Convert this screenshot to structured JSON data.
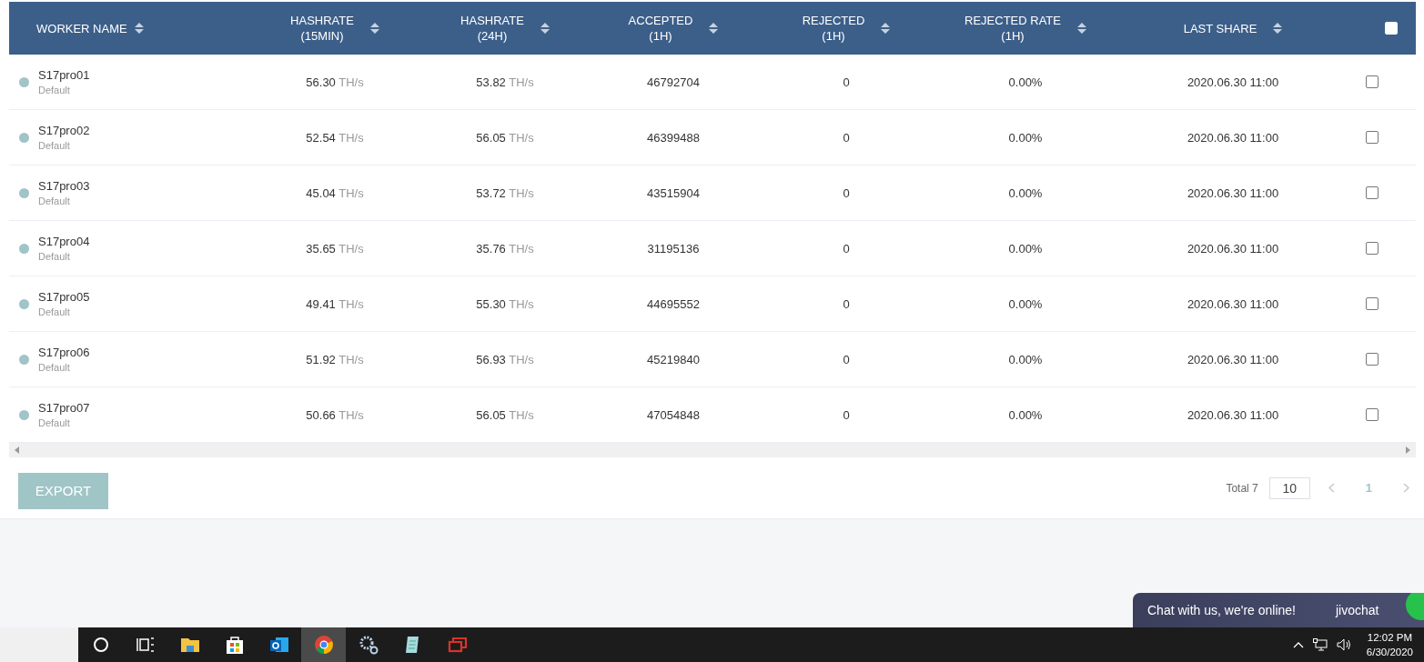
{
  "table": {
    "columns": [
      {
        "label": "WORKER NAME"
      },
      {
        "label": "HASHRATE\n(15MIN)"
      },
      {
        "label": "HASHRATE\n(24H)"
      },
      {
        "label": "ACCEPTED\n(1H)"
      },
      {
        "label": "REJECTED\n(1H)"
      },
      {
        "label": "REJECTED RATE\n(1H)"
      },
      {
        "label": "LAST SHARE"
      }
    ],
    "select_all": {
      "checked": false
    },
    "rows": [
      {
        "name": "S17pro01",
        "group": "Default",
        "color": "#a0c4c8",
        "hashrate_15min": "56.30",
        "unit_15min": "TH/s",
        "hashrate_24h": "53.82",
        "unit_24h": "TH/s",
        "accepted": "46792704",
        "rejected": "0",
        "rejected_rate": "0.00%",
        "last_share": "2020.06.30 11:00",
        "checked": false
      },
      {
        "name": "S17pro02",
        "group": "Default",
        "color": "#a0c4c8",
        "hashrate_15min": "52.54",
        "unit_15min": "TH/s",
        "hashrate_24h": "56.05",
        "unit_24h": "TH/s",
        "accepted": "46399488",
        "rejected": "0",
        "rejected_rate": "0.00%",
        "last_share": "2020.06.30 11:00",
        "checked": false
      },
      {
        "name": "S17pro03",
        "group": "Default",
        "color": "#a0c4c8",
        "hashrate_15min": "45.04",
        "unit_15min": "TH/s",
        "hashrate_24h": "53.72",
        "unit_24h": "TH/s",
        "accepted": "43515904",
        "rejected": "0",
        "rejected_rate": "0.00%",
        "last_share": "2020.06.30 11:00",
        "checked": false
      },
      {
        "name": "S17pro04",
        "group": "Default",
        "color": "#a0c4c8",
        "hashrate_15min": "35.65",
        "unit_15min": "TH/s",
        "hashrate_24h": "35.76",
        "unit_24h": "TH/s",
        "accepted": "31195136",
        "rejected": "0",
        "rejected_rate": "0.00%",
        "last_share": "2020.06.30 11:00",
        "checked": false
      },
      {
        "name": "S17pro05",
        "group": "Default",
        "color": "#a0c4c8",
        "hashrate_15min": "49.41",
        "unit_15min": "TH/s",
        "hashrate_24h": "55.30",
        "unit_24h": "TH/s",
        "accepted": "44695552",
        "rejected": "0",
        "rejected_rate": "0.00%",
        "last_share": "2020.06.30 11:00",
        "checked": false
      },
      {
        "name": "S17pro06",
        "group": "Default",
        "color": "#a0c4c8",
        "hashrate_15min": "51.92",
        "unit_15min": "TH/s",
        "hashrate_24h": "56.93",
        "unit_24h": "TH/s",
        "accepted": "45219840",
        "rejected": "0",
        "rejected_rate": "0.00%",
        "last_share": "2020.06.30 11:00",
        "checked": false
      },
      {
        "name": "S17pro07",
        "group": "Default",
        "color": "#a0c4c8",
        "hashrate_15min": "50.66",
        "unit_15min": "TH/s",
        "hashrate_24h": "56.05",
        "unit_24h": "TH/s",
        "accepted": "47054848",
        "rejected": "0",
        "rejected_rate": "0.00%",
        "last_share": "2020.06.30 11:00",
        "checked": false
      }
    ]
  },
  "export_button": "EXPORT",
  "pagination": {
    "total": "Total 7",
    "page_size": "10",
    "pages": [
      {
        "label": "1",
        "selected": true
      }
    ]
  },
  "chat_widget": {
    "text": "Chat with us, we're online!",
    "brand": "jivochat"
  },
  "taskbar": {
    "time": "12:02 PM",
    "date": "6/30/2020",
    "apps": [
      {
        "kind": "search",
        "selected": false
      },
      {
        "kind": "taskview",
        "selected": false
      },
      {
        "kind": "folder",
        "selected": false
      },
      {
        "kind": "store",
        "selected": false
      },
      {
        "kind": "mail",
        "selected": false
      },
      {
        "kind": "browser",
        "selected": true
      },
      {
        "kind": "gears",
        "selected": false
      },
      {
        "kind": "notepad",
        "selected": false
      },
      {
        "kind": "windows",
        "selected": false
      }
    ]
  }
}
